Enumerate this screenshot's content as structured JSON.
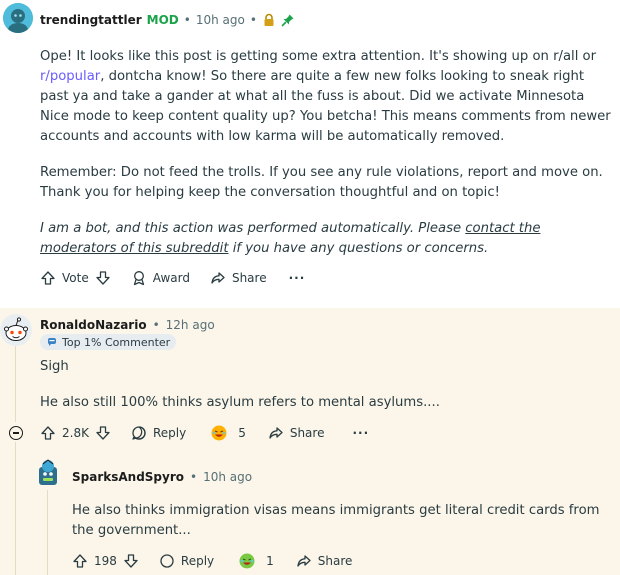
{
  "mod_comment": {
    "author": "trendingtattler",
    "role_badge": "MOD",
    "time": "10h ago",
    "separator": "•",
    "paragraph1_part1": "Ope! It looks like this post is getting some extra attention. It's showing up on r/all or ",
    "paragraph1_link": "r/popular",
    "paragraph1_part2": ", dontcha know! So there are quite a few new folks looking to sneak right past ya and take a gander at what all the fuss is about. Did we activate Minnesota Nice mode to keep content quality up? You betcha! This means comments from newer accounts and accounts with low karma will be automatically removed.",
    "paragraph2": "Remember: Do not feed the trolls. If you see any rule violations, report and move on. Thank you for helping keep the conversation thoughtful and on topic!",
    "bot_note_part1": "I am a bot, and this action was performed automatically. Please ",
    "bot_note_link": "contact the moderators of this subreddit",
    "bot_note_part2": " if you have any questions or concerns.",
    "actions": {
      "vote_label": "Vote",
      "award_label": "Award",
      "share_label": "Share",
      "more_label": "···"
    }
  },
  "comment1": {
    "author": "RonaldoNazario",
    "time": "12h ago",
    "separator": "•",
    "flair": "Top 1% Commenter",
    "line1": "Sigh",
    "line2": "He also still 100% thinks asylum refers to mental asylums....",
    "actions": {
      "score": "2.8K",
      "reply_label": "Reply",
      "award_count": "5",
      "share_label": "Share",
      "more_label": "···"
    }
  },
  "comment2": {
    "author": "SparksAndSpyro",
    "time": "10h ago",
    "separator": "•",
    "body": "He also thinks immigration visas means immigrants get literal credit cards from the government...",
    "actions": {
      "score": "198",
      "reply_label": "Reply",
      "award_count": "1",
      "share_label": "Share"
    }
  },
  "colors": {
    "mod_green": "#1aa34a",
    "link_purple": "#6a5cff",
    "thread_bg": "#fbf6e9",
    "muted_text": "#576f76"
  }
}
